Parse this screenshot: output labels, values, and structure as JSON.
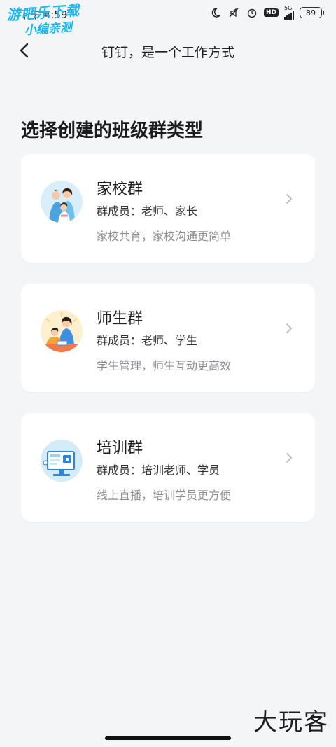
{
  "status_bar": {
    "time": "下午 4:59",
    "network": "5G",
    "hd_label": "HD",
    "battery": "89",
    "icons": [
      "moon-icon",
      "mute-icon",
      "alarm-icon",
      "hd-icon",
      "signal-icon",
      "battery-icon"
    ]
  },
  "watermark": {
    "line1": "游吧乐下载",
    "line2": "小编亲测"
  },
  "nav": {
    "title": "钉钉，是一个工作方式",
    "back_icon": "chevron-left-icon"
  },
  "page": {
    "title": "选择创建的班级群类型"
  },
  "cards": [
    {
      "name": "家校群",
      "members": "群成员：老师、家长",
      "desc": "家校共育，家校沟通更简单",
      "icon": "family-illustration"
    },
    {
      "name": "师生群",
      "members": "群成员：老师、学生",
      "desc": "学生管理，师生互动更高效",
      "icon": "teacher-student-illustration"
    },
    {
      "name": "培训群",
      "members": "群成员：培训老师、学员",
      "desc": "线上直播，培训学员更方便",
      "icon": "monitor-illustration"
    }
  ],
  "brand": "大玩客",
  "colors": {
    "background": "#f4f5f6",
    "card": "#ffffff",
    "watermark": "#18b6f3"
  }
}
